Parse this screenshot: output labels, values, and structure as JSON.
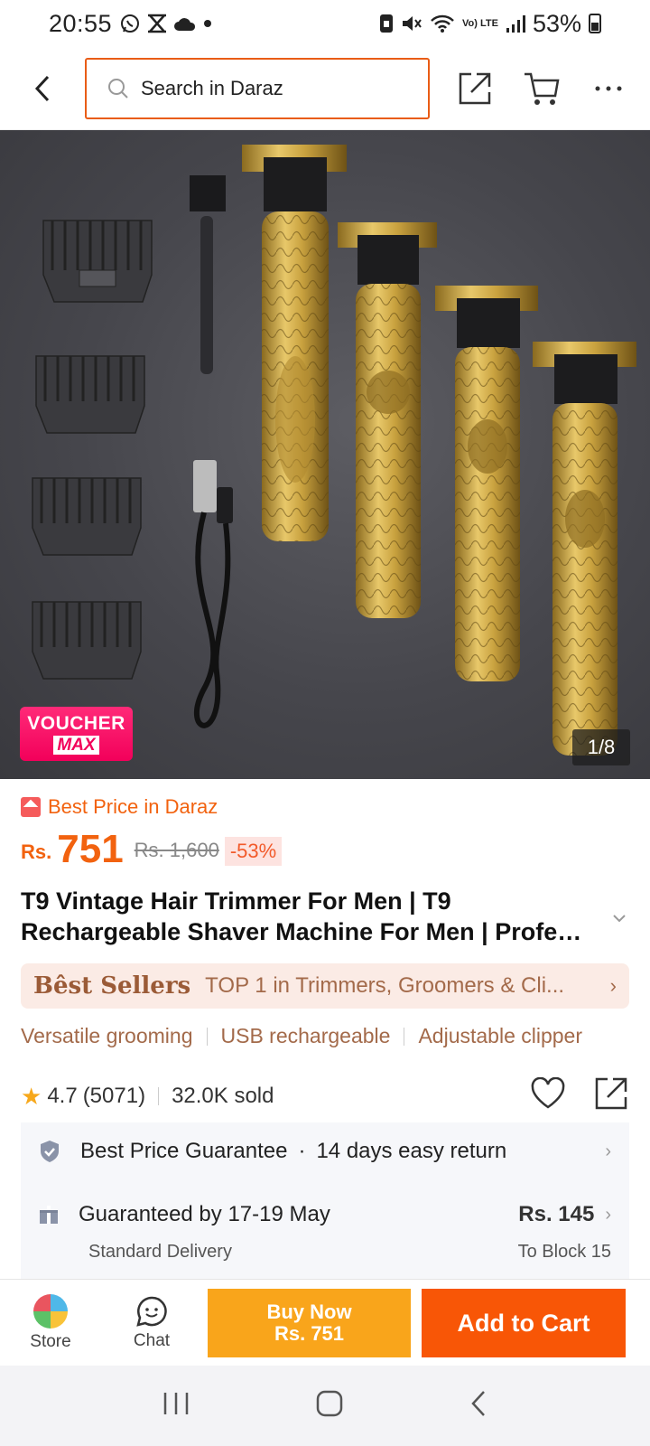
{
  "status": {
    "time": "20:55",
    "battery": "53%",
    "network": "Vo) LTE"
  },
  "header": {
    "search_placeholder": "Search in Daraz"
  },
  "gallery": {
    "counter": "1/8",
    "voucher_line1": "VOUCHER",
    "voucher_line2": "MAX"
  },
  "product": {
    "best_price_label": "Best Price in Daraz",
    "currency": "Rs.",
    "price": "751",
    "old_price": "Rs. 1,600",
    "discount": "-53%",
    "title": "T9 Vintage Hair Trimmer For Men | T9 Rechargeable Shaver Machine For Men | Profe…",
    "best_sellers_label": "Bêst Sellers",
    "best_sellers_text": "TOP 1 in Trimmers, Groomers & Cli...",
    "tags": [
      "Versatile grooming",
      "USB rechargeable",
      "Adjustable clipper"
    ],
    "rating": "4.7",
    "rating_count": "(5071)",
    "sold": "32.0K sold"
  },
  "info": {
    "guarantee": "Best Price Guarantee",
    "returns": "14 days easy return",
    "delivery": "Guaranteed by 17-19 May",
    "delivery_type": "Standard Delivery",
    "fee": "Rs. 145",
    "destination": "To Block 15"
  },
  "bottom": {
    "store_label": "Store",
    "chat_label": "Chat",
    "buy_now_line1": "Buy Now",
    "buy_now_line2": "Rs. 751",
    "add_to_cart": "Add to Cart"
  },
  "colors": {
    "accent_orange": "#f85606",
    "buy_now_yellow": "#f9a51b",
    "price_orange": "#f2620f"
  }
}
